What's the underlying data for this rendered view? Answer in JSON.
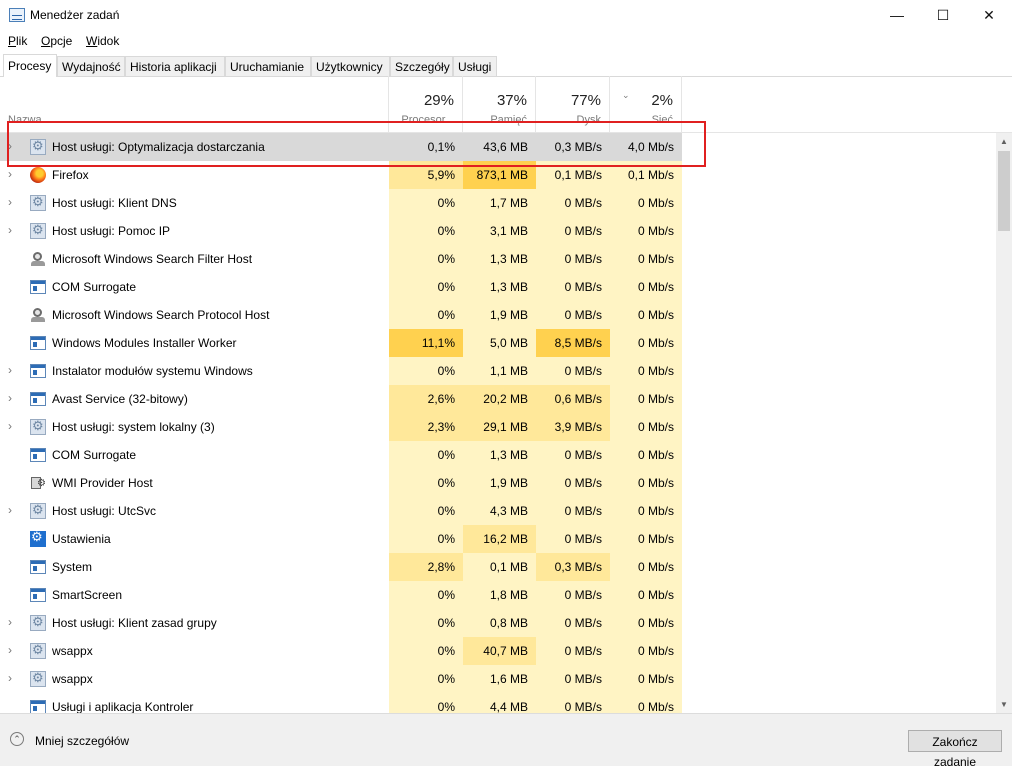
{
  "window": {
    "title": "Menedżer zadań"
  },
  "window_controls": {
    "minimize": "—",
    "maximize": "☐",
    "close": "✕"
  },
  "menu": [
    {
      "u": "P",
      "rest": "lik"
    },
    {
      "u": "O",
      "rest": "pcje"
    },
    {
      "u": "W",
      "rest": "idok"
    }
  ],
  "tabs": [
    "Procesy",
    "Wydajność",
    "Historia aplikacji",
    "Uruchamianie",
    "Użytkownicy",
    "Szczegóły",
    "Usługi"
  ],
  "active_tab": "Procesy",
  "columns": {
    "name": "Nazwa",
    "cpu": {
      "pct": "29%",
      "label": "Procesor..."
    },
    "mem": {
      "pct": "37%",
      "label": "Pamięć"
    },
    "disk": {
      "pct": "77%",
      "label": "Dysk"
    },
    "net": {
      "pct": "2%",
      "label": "Sieć"
    }
  },
  "colors": {
    "heat1": "#fff4c4",
    "heat2": "#ffe89a",
    "heat3": "#ffd14f",
    "selected": "#d9d9d9",
    "highlight_box": "#e02020"
  },
  "rows": [
    {
      "name": "Host usługi: Optymalizacja dostarczania",
      "icon": "service-gear-icon",
      "expandable": true,
      "cpu": "0,1%",
      "mem": "43,6 MB",
      "disk": "0,3 MB/s",
      "net": "4,0 Mb/s",
      "selected": true
    },
    {
      "name": "Firefox",
      "icon": "firefox-icon",
      "expandable": true,
      "cpu": "5,9%",
      "mem": "873,1 MB",
      "disk": "0,1 MB/s",
      "net": "0,1 Mb/s"
    },
    {
      "name": "Host usługi: Klient DNS",
      "icon": "service-gear-icon",
      "expandable": true,
      "cpu": "0%",
      "mem": "1,7 MB",
      "disk": "0 MB/s",
      "net": "0 Mb/s"
    },
    {
      "name": "Host usługi: Pomoc IP",
      "icon": "service-gear-icon",
      "expandable": true,
      "cpu": "0%",
      "mem": "3,1 MB",
      "disk": "0 MB/s",
      "net": "0 Mb/s"
    },
    {
      "name": "Microsoft Windows Search Filter Host",
      "icon": "search-user-icon",
      "expandable": false,
      "cpu": "0%",
      "mem": "1,3 MB",
      "disk": "0 MB/s",
      "net": "0 Mb/s"
    },
    {
      "name": "COM Surrogate",
      "icon": "window-app-icon",
      "expandable": false,
      "cpu": "0%",
      "mem": "1,3 MB",
      "disk": "0 MB/s",
      "net": "0 Mb/s"
    },
    {
      "name": "Microsoft Windows Search Protocol Host",
      "icon": "search-user-icon",
      "expandable": false,
      "cpu": "0%",
      "mem": "1,9 MB",
      "disk": "0 MB/s",
      "net": "0 Mb/s"
    },
    {
      "name": "Windows Modules Installer Worker",
      "icon": "window-app-icon",
      "expandable": false,
      "cpu": "11,1%",
      "mem": "5,0 MB",
      "disk": "8,5 MB/s",
      "net": "0 Mb/s"
    },
    {
      "name": "Instalator modułów systemu Windows",
      "icon": "window-app-icon",
      "expandable": true,
      "cpu": "0%",
      "mem": "1,1 MB",
      "disk": "0 MB/s",
      "net": "0 Mb/s"
    },
    {
      "name": "Avast Service (32-bitowy)",
      "icon": "window-app-icon",
      "expandable": true,
      "cpu": "2,6%",
      "mem": "20,2 MB",
      "disk": "0,6 MB/s",
      "net": "0 Mb/s"
    },
    {
      "name": "Host usługi: system lokalny (3)",
      "icon": "service-gear-icon",
      "expandable": true,
      "cpu": "2,3%",
      "mem": "29,1 MB",
      "disk": "3,9 MB/s",
      "net": "0 Mb/s"
    },
    {
      "name": "COM Surrogate",
      "icon": "window-app-icon",
      "expandable": false,
      "cpu": "0%",
      "mem": "1,3 MB",
      "disk": "0 MB/s",
      "net": "0 Mb/s"
    },
    {
      "name": "WMI Provider Host",
      "icon": "wmi-icon",
      "expandable": false,
      "cpu": "0%",
      "mem": "1,9 MB",
      "disk": "0 MB/s",
      "net": "0 Mb/s"
    },
    {
      "name": "Host usługi: UtcSvc",
      "icon": "service-gear-icon",
      "expandable": true,
      "cpu": "0%",
      "mem": "4,3 MB",
      "disk": "0 MB/s",
      "net": "0 Mb/s"
    },
    {
      "name": "Ustawienia",
      "icon": "settings-gear-icon",
      "expandable": false,
      "cpu": "0%",
      "mem": "16,2 MB",
      "disk": "0 MB/s",
      "net": "0 Mb/s"
    },
    {
      "name": "System",
      "icon": "window-app-icon",
      "expandable": false,
      "cpu": "2,8%",
      "mem": "0,1 MB",
      "disk": "0,3 MB/s",
      "net": "0 Mb/s"
    },
    {
      "name": "SmartScreen",
      "icon": "window-app-icon",
      "expandable": false,
      "cpu": "0%",
      "mem": "1,8 MB",
      "disk": "0 MB/s",
      "net": "0 Mb/s"
    },
    {
      "name": "Host usługi: Klient zasad grupy",
      "icon": "service-gear-icon",
      "expandable": true,
      "cpu": "0%",
      "mem": "0,8 MB",
      "disk": "0 MB/s",
      "net": "0 Mb/s"
    },
    {
      "name": "wsappx",
      "icon": "service-gear-icon",
      "expandable": true,
      "cpu": "0%",
      "mem": "40,7 MB",
      "disk": "0 MB/s",
      "net": "0 Mb/s"
    },
    {
      "name": "wsappx",
      "icon": "service-gear-icon",
      "expandable": true,
      "cpu": "0%",
      "mem": "1,6 MB",
      "disk": "0 MB/s",
      "net": "0 Mb/s"
    },
    {
      "name": "Usługi i aplikacja Kontroler",
      "icon": "window-app-icon",
      "expandable": false,
      "cpu": "0%",
      "mem": "4,4 MB",
      "disk": "0 MB/s",
      "net": "0 Mb/s"
    }
  ],
  "footer": {
    "less_details": "Mniej szczegółów",
    "end_task": "Zakończ zadanie"
  }
}
